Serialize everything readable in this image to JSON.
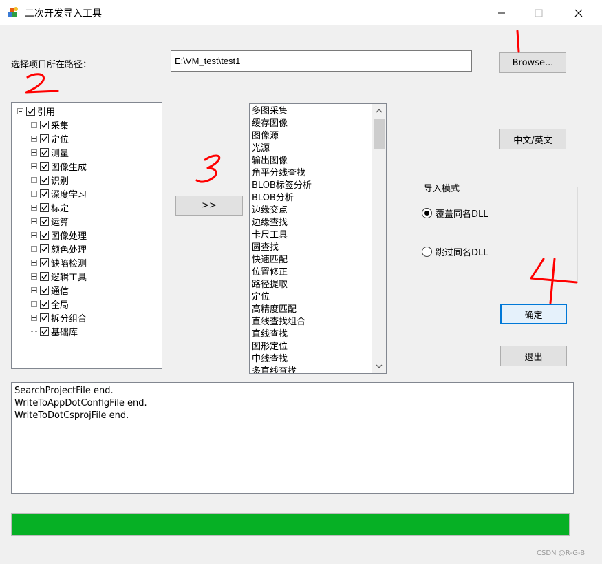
{
  "window": {
    "title": "二次开发导入工具",
    "app_icon": "app-icon",
    "controls": [
      "minimize-icon",
      "maximize-icon",
      "close-icon"
    ]
  },
  "path": {
    "label": "选择项目所在路径：",
    "value": "E:\\VM_test\\test1",
    "browse_label": "Browse..."
  },
  "tree": {
    "root": {
      "label": "引用",
      "checked": true
    },
    "items": [
      {
        "label": "采集",
        "checked": true
      },
      {
        "label": "定位",
        "checked": true
      },
      {
        "label": "测量",
        "checked": true
      },
      {
        "label": "图像生成",
        "checked": true
      },
      {
        "label": "识别",
        "checked": true
      },
      {
        "label": "深度学习",
        "checked": true
      },
      {
        "label": "标定",
        "checked": true
      },
      {
        "label": "运算",
        "checked": true
      },
      {
        "label": "图像处理",
        "checked": true
      },
      {
        "label": "颜色处理",
        "checked": true
      },
      {
        "label": "缺陷检测",
        "checked": true
      },
      {
        "label": "逻辑工具",
        "checked": true
      },
      {
        "label": "通信",
        "checked": true
      },
      {
        "label": "全局",
        "checked": true
      },
      {
        "label": "拆分组合",
        "checked": true
      },
      {
        "label": "基础库",
        "checked": true
      }
    ]
  },
  "transfer_button_label": ">>",
  "module_list": {
    "items": [
      "多图采集",
      "缓存图像",
      "图像源",
      "光源",
      "输出图像",
      "角平分线查找",
      "BLOB标签分析",
      "BLOB分析",
      "边缘交点",
      "边缘查找",
      "卡尺工具",
      "圆查找",
      "快速匹配",
      "位置修正",
      "路径提取",
      "定位",
      "高精度匹配",
      "直线查找组合",
      "直线查找",
      "图形定位",
      "中线查找",
      "多直线查找"
    ]
  },
  "language_button_label": "中文/英文",
  "import_mode": {
    "title": "导入模式",
    "options": [
      {
        "label": "覆盖同名DLL",
        "selected": true
      },
      {
        "label": "跳过同名DLL",
        "selected": false
      }
    ]
  },
  "confirm_label": "确定",
  "exit_label": "退出",
  "log": {
    "lines": [
      "SearchProjectFile end.",
      "WriteToAppDotConfigFile end.",
      "WriteToDotCsprojFile end."
    ]
  },
  "progress": {
    "value_percent": 100,
    "color": "#06b025"
  },
  "watermark": "CSDN @R-G-B",
  "annotations": {
    "color": "#ff0000",
    "marks": [
      "1",
      "2",
      "3",
      "4"
    ]
  }
}
